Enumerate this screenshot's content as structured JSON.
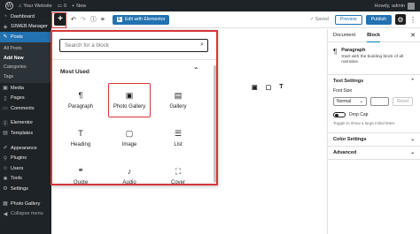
{
  "adminbar": {
    "site_name": "Your Website",
    "comments_count": "0",
    "new_label": "New",
    "greeting": "Howdy, admin"
  },
  "menu": {
    "dashboard": "Dashboard",
    "tenweb": "10WEB Manager",
    "posts": "Posts",
    "posts_sub": [
      "All Posts",
      "Add New",
      "Categories",
      "Tags"
    ],
    "media": "Media",
    "pages": "Pages",
    "comments": "Comments",
    "elementor": "Elementor",
    "templates": "Templates",
    "appearance": "Appearance",
    "plugins": "Plugins",
    "users": "Users",
    "tools": "Tools",
    "settings": "Settings",
    "photo_gallery": "Photo Gallery",
    "collapse": "Collapse menu"
  },
  "header": {
    "add_icon": "+",
    "undo_icon": "↶",
    "redo_icon": "↷",
    "info_icon": "ⓘ",
    "list_icon": "≡",
    "elementor_label": "Edit with Elementor",
    "saved_label": "✓ Saved",
    "preview_label": "Preview",
    "publish_label": "Publish",
    "settings_icon": "⚙",
    "more_icon": "⋮"
  },
  "inserter": {
    "search_placeholder": "Search for a block",
    "category": "Most Used",
    "blocks": [
      {
        "label": "Paragraph",
        "icon": "¶",
        "icon_name": "paragraph-icon"
      },
      {
        "label": "Photo Gallery",
        "icon": "▣",
        "icon_name": "photo-gallery-icon"
      },
      {
        "label": "Gallery",
        "icon": "▤",
        "icon_name": "gallery-icon"
      },
      {
        "label": "Heading",
        "icon": "T",
        "icon_name": "heading-icon"
      },
      {
        "label": "Image",
        "icon": "▢",
        "icon_name": "image-icon"
      },
      {
        "label": "List",
        "icon": "☰",
        "icon_name": "list-icon"
      },
      {
        "label": "Quote",
        "icon": "❝",
        "icon_name": "quote-icon"
      },
      {
        "label": "Audio",
        "icon": "♪",
        "icon_name": "audio-icon"
      },
      {
        "label": "Cover",
        "icon": "⛶",
        "icon_name": "cover-icon"
      }
    ]
  },
  "canvas": {
    "quick_blocks": [
      "▣",
      "▢",
      "T"
    ]
  },
  "sidebar": {
    "tab_document": "Document",
    "tab_block": "Block",
    "block_name": "Paragraph",
    "block_desc": "Start with the building block of all narrative.",
    "text_settings": "Text Settings",
    "font_size_label": "Font Size",
    "font_size_value": "Normal",
    "reset_label": "Reset",
    "drop_cap_label": "Drop Cap",
    "drop_cap_hint": "Toggle to show a large initial letter.",
    "color_settings": "Color Settings",
    "advanced": "Advanced"
  },
  "colors": {
    "accent": "#2271b1",
    "highlight": "#d63638",
    "admin_bg": "#1d2327"
  }
}
